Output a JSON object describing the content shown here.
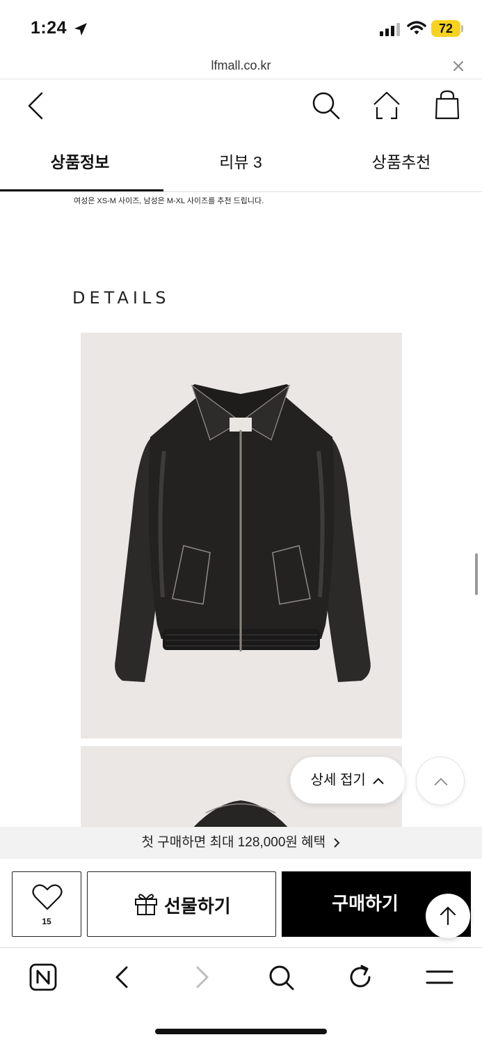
{
  "status_bar": {
    "time": "1:24",
    "battery": "72"
  },
  "url_bar": {
    "domain": "lfmall.co.kr"
  },
  "header": {
    "back_icon": "chevron-left-icon",
    "search_icon": "search-icon",
    "home_icon": "home-icon",
    "cart_icon": "shopping-bag-icon"
  },
  "tabs": [
    {
      "label": "상품정보",
      "active": true
    },
    {
      "label": "리뷰 3",
      "active": false
    },
    {
      "label": "상품추천",
      "active": false
    }
  ],
  "content": {
    "size_note": "여성은 XS-M 사이즈, 남성은 M-XL 사이즈를 추천 드립니다.",
    "details_heading": "DETAILS"
  },
  "floating": {
    "collapse_label": "상세 접기"
  },
  "promo": {
    "text": "첫 구매하면 최대 128,000원 혜택"
  },
  "actions": {
    "wish_count": "15",
    "gift_label": "선물하기",
    "buy_label": "구매하기"
  },
  "browser_toolbar": {
    "icons": [
      "naver-n-icon",
      "back-arrow-icon",
      "forward-arrow-icon",
      "search-icon",
      "reload-icon",
      "menu-icon"
    ]
  },
  "colors": {
    "accent": "#000000",
    "battery": "#f7d21f",
    "photo_bg": "#eae7e5"
  }
}
